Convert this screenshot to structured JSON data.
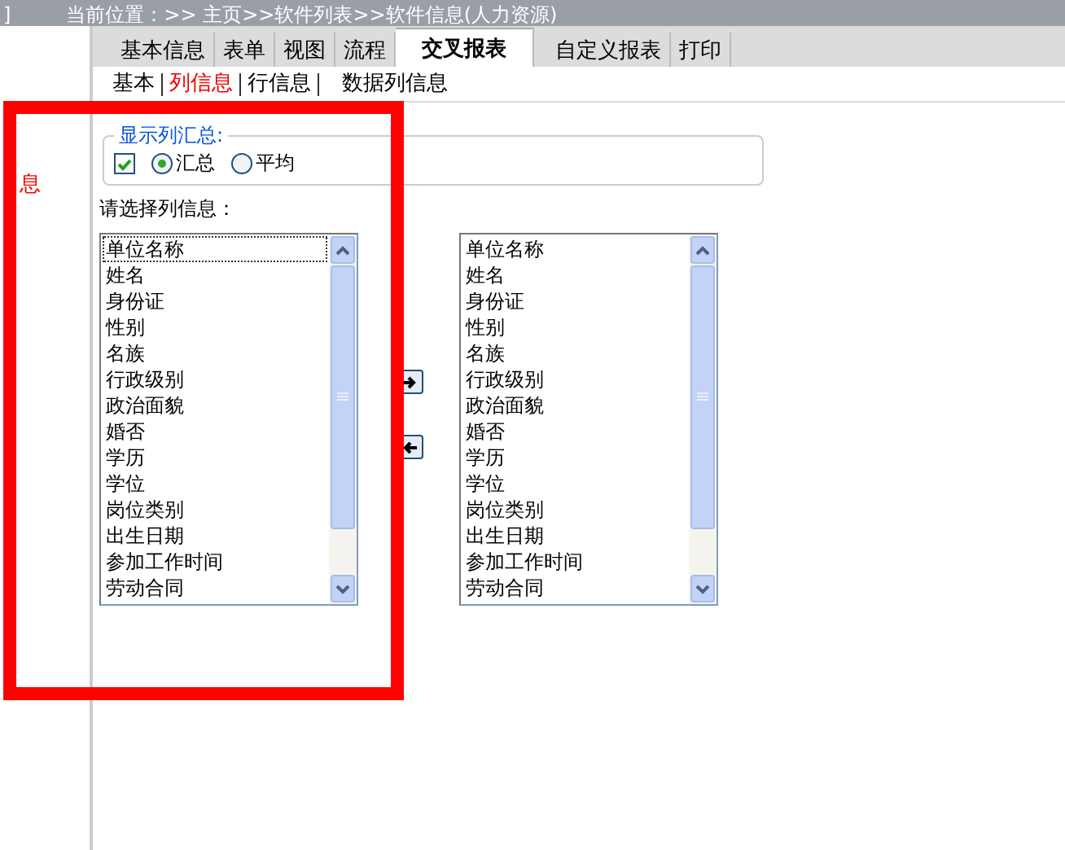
{
  "top_bar": {
    "edge_fragment": "]",
    "breadcrumb": "当前位置：>> 主页>>软件列表>>软件信息(人力资源)"
  },
  "sidebar": {
    "fragment": "息"
  },
  "tabs": [
    {
      "label": "基本信息",
      "selected": false
    },
    {
      "label": "表单",
      "selected": false
    },
    {
      "label": "视图",
      "selected": false
    },
    {
      "label": "流程",
      "selected": false
    },
    {
      "label": "交叉报表",
      "selected": true
    },
    {
      "label": "自定义报表",
      "selected": false
    },
    {
      "label": "打印",
      "selected": false
    }
  ],
  "subtabs": [
    {
      "label": "基本",
      "selected": false
    },
    {
      "label": "列信息",
      "selected": true
    },
    {
      "label": "行信息",
      "selected": false
    },
    {
      "label": "数据列信息",
      "selected": false
    }
  ],
  "summary": {
    "legend": "显示列汇总:",
    "checked": true,
    "options": [
      {
        "label": "汇总",
        "selected": true
      },
      {
        "label": "平均",
        "selected": false
      }
    ]
  },
  "select_label": "请选择列信息：",
  "left_list": [
    {
      "label": "单位名称",
      "focused": true
    },
    {
      "label": "姓名",
      "focused": false
    },
    {
      "label": "身份证",
      "focused": false
    },
    {
      "label": "性别",
      "focused": false
    },
    {
      "label": "名族",
      "focused": false
    },
    {
      "label": "行政级别",
      "focused": false
    },
    {
      "label": "政治面貌",
      "focused": false
    },
    {
      "label": "婚否",
      "focused": false
    },
    {
      "label": "学历",
      "focused": false
    },
    {
      "label": "学位",
      "focused": false
    },
    {
      "label": "岗位类别",
      "focused": false
    },
    {
      "label": "出生日期",
      "focused": false
    },
    {
      "label": "参加工作时间",
      "focused": false
    },
    {
      "label": "劳动合同",
      "focused": false
    }
  ],
  "right_list": [
    "单位名称",
    "姓名",
    "身份证",
    "性别",
    "名族",
    "行政级别",
    "政治面貌",
    "婚否",
    "学历",
    "学位",
    "岗位类别",
    "出生日期",
    "参加工作时间",
    "劳动合同"
  ]
}
